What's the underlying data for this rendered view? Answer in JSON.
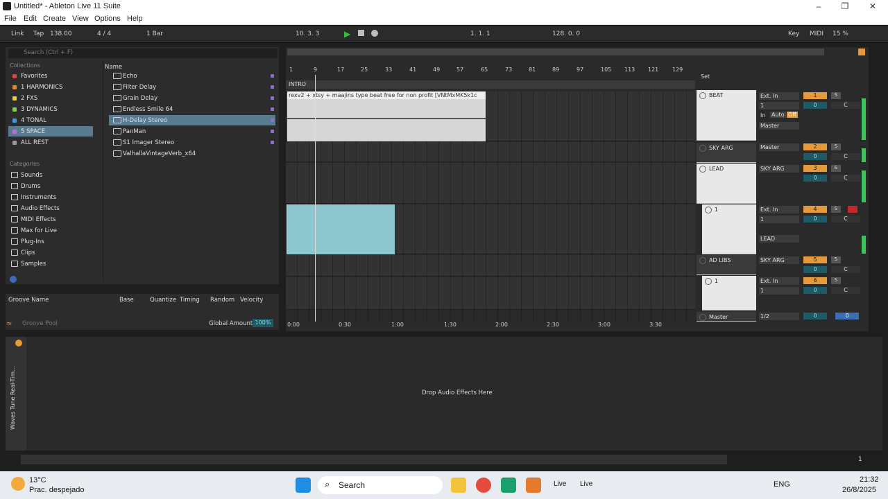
{
  "window": {
    "title": "Untitled* - Ableton Live 11 Suite"
  },
  "menu": [
    "File",
    "Edit",
    "Create",
    "View",
    "Options",
    "Help"
  ],
  "transport": {
    "link": "Link",
    "tap": "Tap",
    "tempo": "138.00",
    "signature": "4 / 4",
    "quantize": "1 Bar",
    "position": "10.   3.   3",
    "loop_start": "1.   1.   1",
    "loop_length": "128.   0.   0",
    "key": "Key",
    "midi": "MIDI",
    "cpu": "15 %"
  },
  "browser": {
    "search_placeholder": "Search (Ctrl + F)",
    "collections_header": "Collections",
    "collections": [
      {
        "label": "Favorites",
        "color": "#e0443c"
      },
      {
        "label": "1 HARMONICS",
        "color": "#e8842c"
      },
      {
        "label": "2 FXS",
        "color": "#e8d23c"
      },
      {
        "label": "3 DYNAMICS",
        "color": "#7cd04c"
      },
      {
        "label": "4 TONAL",
        "color": "#3c9ce8"
      },
      {
        "label": "5 SPACE",
        "color": "#b46cd8"
      },
      {
        "label": "ALL REST",
        "color": "#9a9a9a"
      }
    ],
    "categories_header": "Categories",
    "categories": [
      "Sounds",
      "Drums",
      "Instruments",
      "Audio Effects",
      "MIDI Effects",
      "Max for Live",
      "Plug-Ins",
      "Clips",
      "Samples"
    ],
    "name_header": "Name",
    "files": [
      "Echo",
      "Filter Delay",
      "Grain Delay",
      "Endless Smile 64",
      "H-Delay Stereo",
      "PanMan",
      "S1 Imager Stereo",
      "ValhallaVintageVerb_x64"
    ]
  },
  "groove": {
    "columns": [
      "Groove Name",
      "Base",
      "Quantize",
      "Timing",
      "Random",
      "Velocity"
    ],
    "pool": "Groove Pool",
    "global_amount_label": "Global Amount",
    "global_amount": "100%"
  },
  "arrangement": {
    "bars": [
      "1",
      "9",
      "17",
      "25",
      "33",
      "41",
      "49",
      "57",
      "65",
      "73",
      "81",
      "89",
      "97",
      "105",
      "113",
      "121",
      "129"
    ],
    "locator": "INTRO",
    "clip_name": "rexv2 + xtsy  + maajins type beat   free for non profit   [VNtMxMK5k1c",
    "times": [
      "0:00",
      "0:30",
      "1:00",
      "1:30",
      "2:00",
      "2:30",
      "3:00",
      "3:30"
    ],
    "set_label": "Set"
  },
  "tracks": [
    {
      "name": "BEAT",
      "input": "Ext. In",
      "channel": "1",
      "output": "Master",
      "number": "1",
      "vol": "0",
      "pan": "C"
    },
    {
      "name": "SKY ARG",
      "input": "Master",
      "number": "2",
      "vol": "0",
      "pan": "C"
    },
    {
      "name": "LEAD",
      "input": "SKY ARG",
      "number": "3",
      "vol": "0",
      "pan": "C"
    },
    {
      "name": "1",
      "input": "Ext. In",
      "channel": "1",
      "output": "LEAD",
      "number": "4",
      "vol": "0",
      "pan": "C"
    },
    {
      "name": "AD LIBS",
      "input": "SKY ARG",
      "number": "5",
      "vol": "0",
      "pan": "C"
    },
    {
      "name": "1",
      "input": "Ext. In",
      "channel": "1",
      "number": "6",
      "vol": "0",
      "pan": "C"
    },
    {
      "name": "Master",
      "input": "1/2",
      "vol": "0",
      "pan": "0"
    }
  ],
  "monitor": {
    "in": "In",
    "auto": "Auto",
    "off": "Off"
  },
  "device": {
    "drop_text": "Drop Audio Effects Here",
    "plugin": "Waves Tune Real-Tim..."
  },
  "status": {
    "page": "1"
  },
  "taskbar": {
    "temp": "13°C",
    "weather": "Prac. despejado",
    "search": "Search",
    "lang": "ENG",
    "time": "21:32",
    "date": "26/8/2025",
    "live1": "Live",
    "live2": "Live"
  }
}
